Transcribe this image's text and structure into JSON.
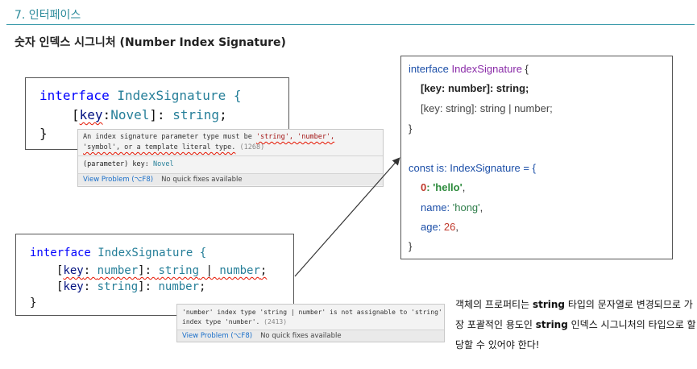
{
  "section": {
    "title": "7. 인터페이스"
  },
  "subtitle": "숫자 인덱스 시그니처 (Number Index Signature)",
  "box1": {
    "line1": {
      "kw": "interface",
      "name": " IndexSignature {"
    },
    "line2": {
      "open": "[",
      "key": "key",
      "colon": ":",
      "type": "Novel",
      "close": "]: ",
      "valtype": "string",
      "semi": ";"
    },
    "line3": "}"
  },
  "hover1": {
    "msg_a": "An index signature parameter type must be ",
    "msg_b": "'string', 'number',",
    "msg_c": "'symbol', or a template literal type.",
    "err": " (1268)",
    "sig_a": "(parameter) key: ",
    "sig_b": "Novel",
    "view": "View Problem (⌥F8)",
    "nofix": "No quick fixes available"
  },
  "box2": {
    "line1": {
      "kw": "interface",
      "name": " IndexSignature {"
    },
    "line2": {
      "open": "[",
      "key": "key",
      "colon": ": ",
      "type": "number",
      "close": "]: ",
      "t1": "string",
      "bar": " | ",
      "t2": "number",
      "semi": ";"
    },
    "line3": {
      "open": "[",
      "key": "key",
      "colon": ": ",
      "type": "string",
      "close": "]: ",
      "valtype": "number",
      "semi": ";"
    },
    "line4": "}"
  },
  "hover2": {
    "msg_a": "'number' index type 'string | number' is not assignable to 'string'",
    "msg_b": "index type 'number'.",
    "err": " (2413)",
    "view": "View Problem (⌥F8)",
    "nofix": "No quick fixes available"
  },
  "right": {
    "r1_kw": "interface ",
    "r1_name": "IndexSignature",
    "r1_brace": " {",
    "r2": "[key: number]: string;",
    "r3": "[key: string]: string | number;",
    "r4": "}",
    "r5": "const is: IndexSignature = {",
    "r6_key": "0",
    "r6_colon": ": ",
    "r6_val": "'hello'",
    "r6_comma": ",",
    "r7_key": "name: ",
    "r7_val": "'hong'",
    "r7_comma": ",",
    "r8_key": "age: ",
    "r8_val": "26",
    "r8_comma": ",",
    "r9": "}"
  },
  "note": {
    "p1": "객체의 프로퍼티는 ",
    "b1": "string",
    "p2": " 타입의 문자열로 변경되므로 가장 포괄적인 용도인 ",
    "b2": "string",
    "p3": " 인덱스 시그니처의 타입으로 할당할 수 있어야 한다!"
  },
  "colors": {
    "accent": "#2a8a9a",
    "keyword": "#0000ff",
    "type": "#267f99",
    "error": "#e51400"
  }
}
